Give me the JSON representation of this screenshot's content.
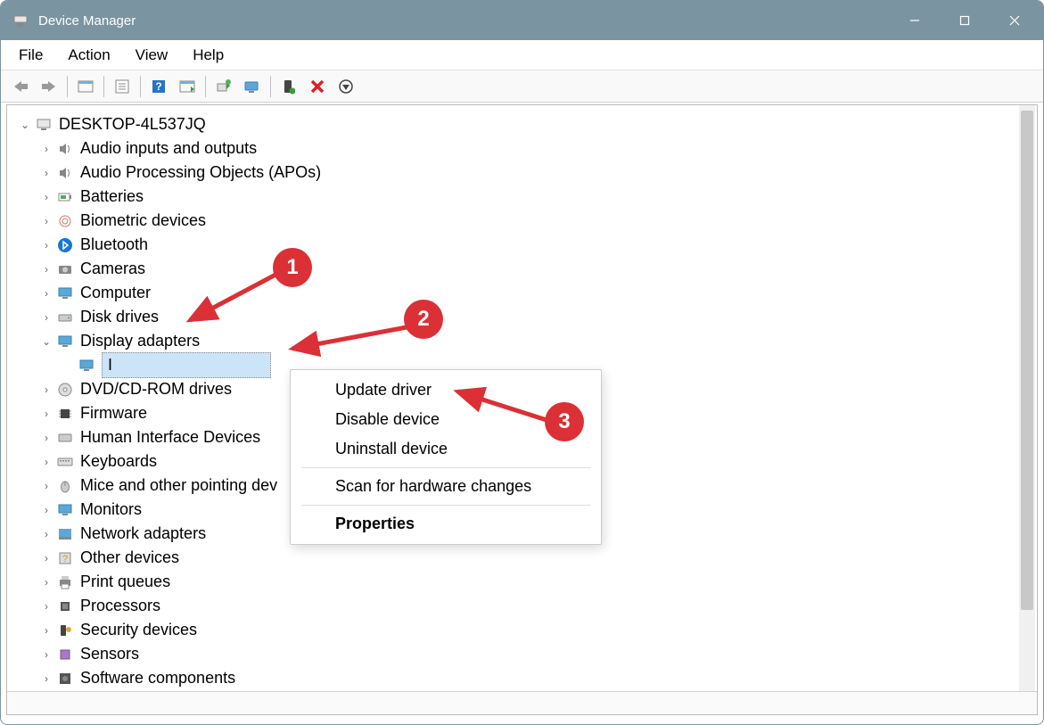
{
  "window": {
    "title": "Device Manager"
  },
  "menu": [
    "File",
    "Action",
    "View",
    "Help"
  ],
  "tree": {
    "root": "DESKTOP-4L537JQ",
    "items": [
      {
        "label": "Audio inputs and outputs",
        "icon": "speaker"
      },
      {
        "label": "Audio Processing Objects (APOs)",
        "icon": "speaker"
      },
      {
        "label": "Batteries",
        "icon": "battery"
      },
      {
        "label": "Biometric devices",
        "icon": "fingerprint"
      },
      {
        "label": "Bluetooth",
        "icon": "bluetooth"
      },
      {
        "label": "Cameras",
        "icon": "camera"
      },
      {
        "label": "Computer",
        "icon": "computer"
      },
      {
        "label": "Disk drives",
        "icon": "disk"
      },
      {
        "label": "Display adapters",
        "icon": "display",
        "expanded": true
      },
      {
        "label": "DVD/CD-ROM drives",
        "icon": "dvd"
      },
      {
        "label": "Firmware",
        "icon": "chip"
      },
      {
        "label": "Human Interface Devices",
        "icon": "hid"
      },
      {
        "label": "Keyboards",
        "icon": "keyboard"
      },
      {
        "label": "Mice and other pointing dev",
        "icon": "mouse"
      },
      {
        "label": "Monitors",
        "icon": "monitor"
      },
      {
        "label": "Network adapters",
        "icon": "network"
      },
      {
        "label": "Other devices",
        "icon": "other"
      },
      {
        "label": "Print queues",
        "icon": "printer"
      },
      {
        "label": "Processors",
        "icon": "cpu"
      },
      {
        "label": "Security devices",
        "icon": "security"
      },
      {
        "label": "Sensors",
        "icon": "sensor"
      },
      {
        "label": "Software components",
        "icon": "software"
      }
    ],
    "selected_child": "I"
  },
  "context_menu": {
    "items": [
      {
        "label": "Update driver"
      },
      {
        "label": "Disable device"
      },
      {
        "label": "Uninstall device"
      },
      {
        "sep": true
      },
      {
        "label": "Scan for hardware changes"
      },
      {
        "sep": true
      },
      {
        "label": "Properties",
        "bold": true
      }
    ]
  },
  "annotations": {
    "1": "1",
    "2": "2",
    "3": "3"
  }
}
